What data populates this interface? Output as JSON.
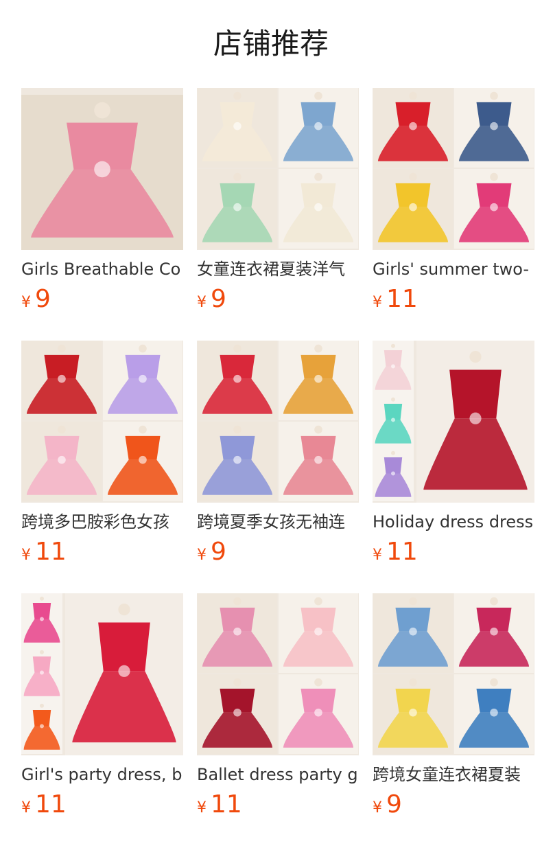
{
  "header": {
    "title": "店铺推荐"
  },
  "products": [
    {
      "name": "Girls Breathable Co",
      "currency": "¥",
      "price": "9",
      "image": "pink-tulle-dress-photo",
      "colors": [
        "#e98aa0",
        "#c54a5b",
        "#f3ede6"
      ]
    },
    {
      "name": "女童连衣裙夏装洋气",
      "currency": "¥",
      "price": "9",
      "image": "four-dress-collage",
      "colors": [
        "#f4ead8",
        "#7ea6cf",
        "#a5d7b4",
        "#f2e9d6"
      ]
    },
    {
      "name": "Girls' summer two-",
      "currency": "¥",
      "price": "11",
      "image": "two-piece-outfits-collage",
      "colors": [
        "#d81f2a",
        "#3d5b8c",
        "#f2c52b",
        "#e23b78"
      ]
    },
    {
      "name": "跨境多巴胺彩色女孩",
      "currency": "¥",
      "price": "11",
      "image": "ruffle-dress-colors-collage",
      "colors": [
        "#c81d24",
        "#b99ee8",
        "#f4b5c8",
        "#f0551b"
      ]
    },
    {
      "name": "跨境夏季女孩无袖连",
      "currency": "¥",
      "price": "9",
      "image": "floral-dress-collage",
      "colors": [
        "#d9283a",
        "#e7a23a",
        "#8f98d8",
        "#e88895"
      ]
    },
    {
      "name": "Holiday dress dress",
      "currency": "¥",
      "price": "11",
      "image": "holiday-tulle-dress-collage",
      "colors": [
        "#b5142a",
        "#f3d1d6",
        "#5bd6c0",
        "#a88ad8"
      ]
    },
    {
      "name": "Girl's party dress, b",
      "currency": "¥",
      "price": "11",
      "image": "party-dress-collage",
      "colors": [
        "#d81c3a",
        "#e84b8f",
        "#f6a9c3",
        "#f35a1c"
      ]
    },
    {
      "name": "Ballet dress party g",
      "currency": "¥",
      "price": "11",
      "image": "ballet-dress-collage",
      "colors": [
        "#e690b0",
        "#f7c1c6",
        "#a4142b",
        "#ef8fb9"
      ]
    },
    {
      "name": "跨境女童连衣裙夏装",
      "currency": "¥",
      "price": "9",
      "image": "summer-dress-collage",
      "colors": [
        "#6f9fd0",
        "#c8285b",
        "#f2d54e",
        "#3f7fc0"
      ]
    }
  ]
}
